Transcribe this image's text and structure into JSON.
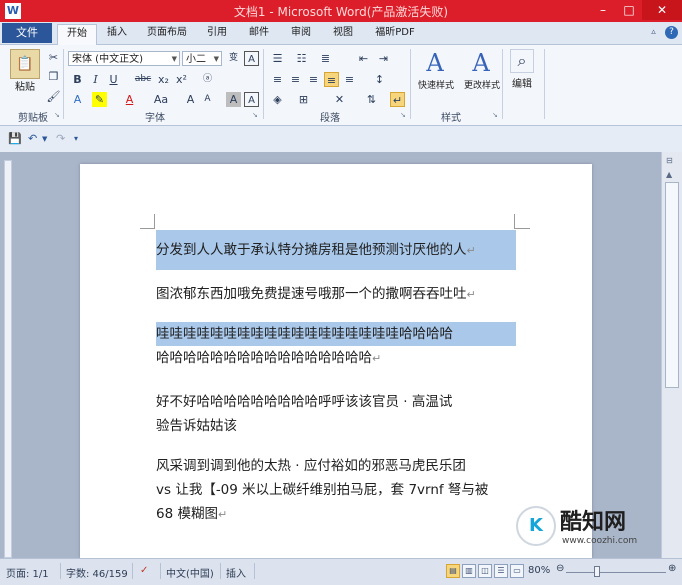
{
  "window": {
    "title": "文档1 - Microsoft Word(产品激活失败)",
    "app_icon": "W",
    "controls": {
      "minimize": "–",
      "maximize": "□",
      "close": "✕"
    }
  },
  "tabs": {
    "file": "文件",
    "items": [
      "开始",
      "插入",
      "页面布局",
      "引用",
      "邮件",
      "审阅",
      "视图",
      "福昕PDF"
    ],
    "active": "开始"
  },
  "ribbon": {
    "clipboard": {
      "paste": "粘贴",
      "label": "剪贴板"
    },
    "font": {
      "name": "宋体 (中文正文)",
      "size": "小二",
      "label": "字体",
      "bold": "B",
      "italic": "I",
      "underline": "U",
      "strikethrough": "abc",
      "subscript": "x₂",
      "superscript": "x²",
      "grow": "A",
      "shrink": "A",
      "font_color": "A",
      "char_shade": "A",
      "text_effect": "Aa"
    },
    "paragraph": {
      "label": "段落"
    },
    "styles": {
      "quick_styles": "快速样式",
      "change_styles": "更改样式",
      "label": "样式"
    },
    "editing": {
      "label": "编辑"
    }
  },
  "document": {
    "paragraphs": [
      {
        "lines": [
          "分发到人人敢于承认特分摊房租是他预测讨厌他的人"
        ],
        "highlighted": true
      },
      {
        "lines": [
          "图浓郁东西加哦免费提速号哦那一个的撒啊吞吞吐吐"
        ],
        "highlighted": false
      },
      {
        "lines": [
          "哇哇哇哇哇哇哇哇哇哇哇哇哇哇哇哇哇哇哈哈哈哈",
          "哈哈哈哈哈哈哈哈哈哈哈哈哈哈哈哈"
        ],
        "highlighted": true
      },
      {
        "lines": [
          "好不好哈哈哈哈哈哈哈哈哈呼呼该该官员 · 高温试",
          "验告诉姑姑该"
        ],
        "highlighted": false
      },
      {
        "lines": [
          "风采调到调到他的太热 · 应付裕如的邪恶马虎民乐团",
          "vs 让我【-09 米以上碳纤维别拍马屁，套 7vrnf 弩与被",
          "68 模糊图"
        ],
        "highlighted": false
      }
    ],
    "paragraph_mark": "↵"
  },
  "statusbar": {
    "page": "页面: 1/1",
    "words": "字数: 46/159",
    "language": "中文(中国)",
    "mode": "插入",
    "zoom": "80%"
  },
  "watermark": {
    "brand": "酷知网",
    "url": "www.coozhi.com",
    "logo": "K"
  },
  "colors": {
    "title_bar": "#dc1e2a",
    "file_tab": "#2b579a",
    "selection": "#a9c8ea"
  }
}
